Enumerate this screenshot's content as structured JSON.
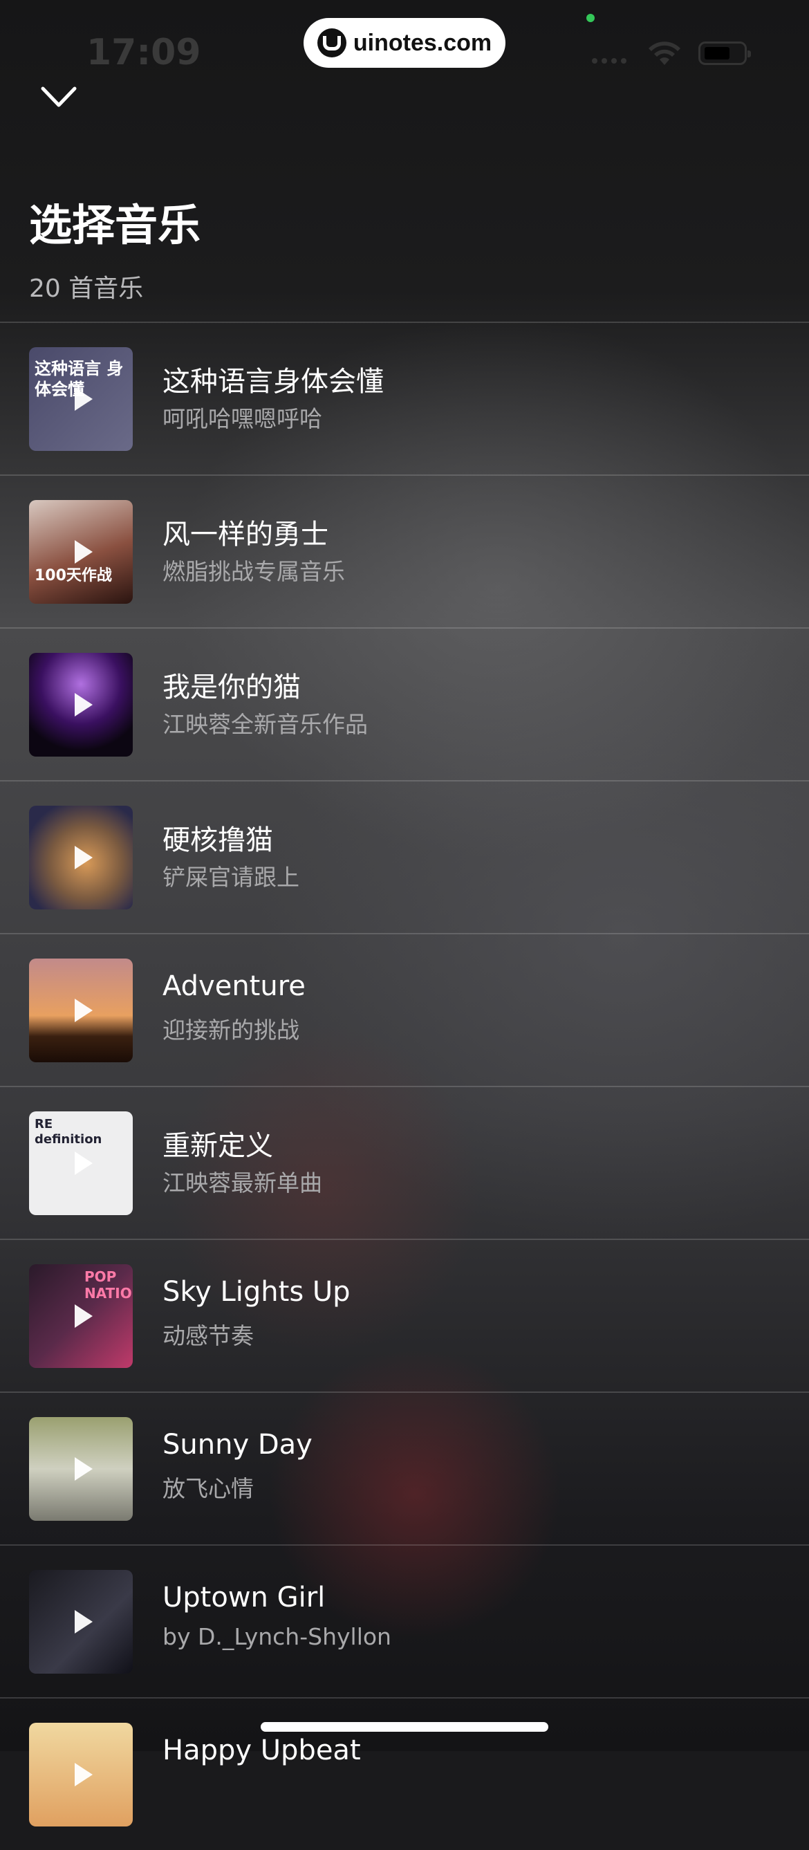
{
  "status_bar": {
    "time": "17:09",
    "url": "uinotes.com"
  },
  "header": {
    "title": "选择音乐",
    "count": "20 首音乐"
  },
  "songs": [
    {
      "title": "这种语言身体会懂",
      "subtitle": "呵吼哈嘿嗯呼哈",
      "cover_text": "这种语言 身体会懂"
    },
    {
      "title": "风一样的勇士",
      "subtitle": "燃脂挑战专属音乐",
      "cover_text": "100天作战"
    },
    {
      "title": "我是你的猫",
      "subtitle": "江映蓉全新音乐作品"
    },
    {
      "title": "硬核撸猫",
      "subtitle": "铲屎官请跟上"
    },
    {
      "title": "Adventure",
      "subtitle": "迎接新的挑战"
    },
    {
      "title": "重新定义",
      "subtitle": "江映蓉最新单曲",
      "cover_text": "RE definition"
    },
    {
      "title": "Sky Lights Up",
      "subtitle": "动感节奏",
      "cover_text": "POP NATION"
    },
    {
      "title": "Sunny Day",
      "subtitle": "放飞心情"
    },
    {
      "title": "Uptown Girl",
      "subtitle": "by D._Lynch-Shyllon"
    },
    {
      "title": "Happy Upbeat",
      "subtitle": ""
    }
  ],
  "icons": {
    "collapse": "chevron-down-icon",
    "play": "play-icon",
    "wifi": "wifi-icon",
    "battery": "battery-icon"
  }
}
